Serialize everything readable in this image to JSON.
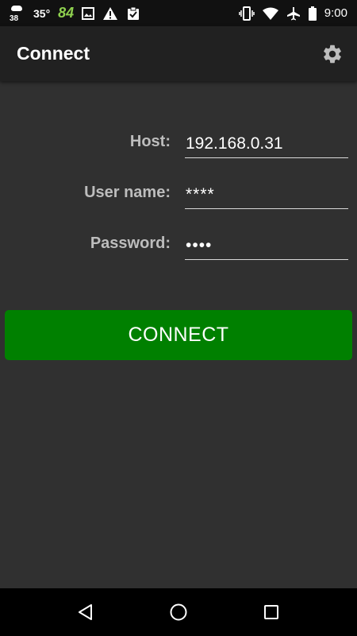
{
  "status_bar": {
    "weather_temp_small": "38",
    "temperature": "35°",
    "aqi": "84",
    "time": "9:00",
    "icons": [
      "weather-icon",
      "image-icon",
      "warning-icon",
      "clipboard-check-icon",
      "vibrate-icon",
      "wifi-icon",
      "airplane-icon",
      "battery-icon"
    ]
  },
  "app_bar": {
    "title": "Connect",
    "settings_icon": "gear-icon"
  },
  "form": {
    "host_label": "Host:",
    "host_value": "192.168.0.31",
    "username_label": "User name:",
    "username_value": "****",
    "password_label": "Password:",
    "password_value": "••••"
  },
  "connect_button": {
    "label": "CONNECT",
    "color": "#008000"
  },
  "nav_bar": {
    "icons": [
      "back-icon",
      "home-icon",
      "recents-icon"
    ]
  }
}
